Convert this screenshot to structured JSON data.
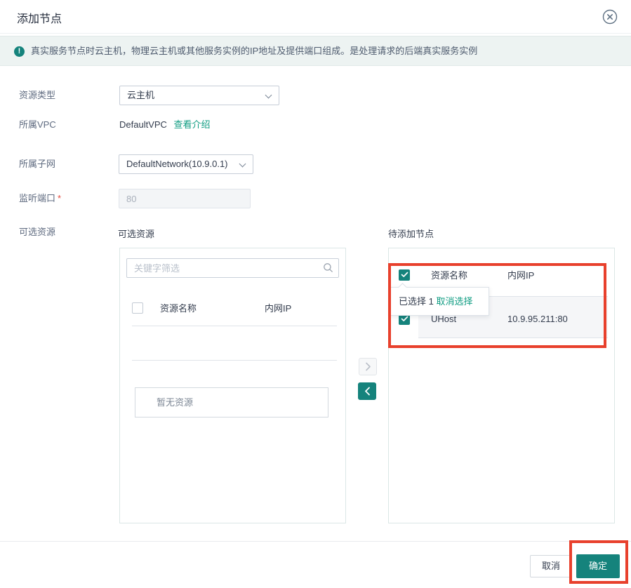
{
  "dialog": {
    "title": "添加节点"
  },
  "banner": {
    "icon_glyph": "!",
    "text": "真实服务节点时云主机，物理云主机或其他服务实例的IP地址及提供端口组成。是处理请求的后端真实服务实例"
  },
  "form": {
    "resource_type": {
      "label": "资源类型",
      "value": "云主机"
    },
    "vpc": {
      "label": "所属VPC",
      "value": "DefaultVPC",
      "link": "查看介绍"
    },
    "subnet": {
      "label": "所属子网",
      "value": "DefaultNetwork(10.9.0.1)"
    },
    "port": {
      "label": "监听端口",
      "required_mark": "*",
      "value": "80"
    },
    "resources": {
      "label": "可选资源"
    }
  },
  "transfer": {
    "left": {
      "heading": "可选资源",
      "search_placeholder": "关键字筛选",
      "columns": [
        "资源名称",
        "内网IP"
      ],
      "empty_text": "暂无资源"
    },
    "right": {
      "heading": "待添加节点",
      "columns": [
        "资源名称",
        "内网IP"
      ],
      "rows": [
        {
          "name": "UHost",
          "ip": "10.9.95.211:80"
        }
      ]
    },
    "tooltip": {
      "selected_text": "已选择 1",
      "action": "取消选择"
    },
    "icons": {
      "to_right": "chevron-right",
      "to_left": "chevron-left",
      "search": "magnifier",
      "close": "circle-x",
      "checked": "check"
    }
  },
  "footer": {
    "cancel_label": "取消",
    "confirm_label": "确定"
  },
  "colors": {
    "accent_teal": "#15837c",
    "link_teal": "#0f9c82",
    "annotation_red": "#e8402c",
    "banner_bg": "#edf3f2",
    "row_selected_bg": "#f5f6f8"
  }
}
